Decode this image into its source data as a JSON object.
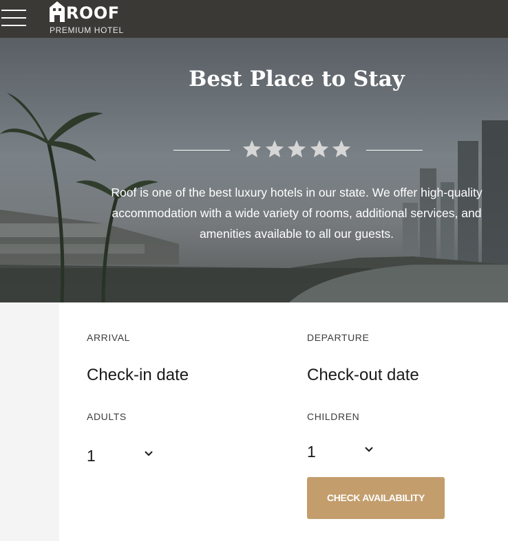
{
  "header": {
    "menu_icon": "hamburger-menu-icon",
    "logo_name": "ROOF",
    "logo_tagline": "PREMIUM HOTEL",
    "background_color": "#3b3936"
  },
  "hero": {
    "title": "Best Place to Stay",
    "rating_stars": 5,
    "star_icon": "star-icon",
    "description": "Roof is one of the best luxury hotels in our state. We offer high-quality accommodation with a wide variety of rooms, additional services, and amenities available to all our guests."
  },
  "booking": {
    "arrival_label": "ARRIVAL",
    "arrival_value": "Check-in date",
    "departure_label": "DEPARTURE",
    "departure_value": "Check-out date",
    "adults_label": "ADULTS",
    "adults_value": "1",
    "children_label": "CHILDREN",
    "children_value": "1",
    "chevron_icon": "chevron-down-icon",
    "submit_label": "CHECK AVAILABILITY",
    "accent_color": "#c39d6c"
  }
}
